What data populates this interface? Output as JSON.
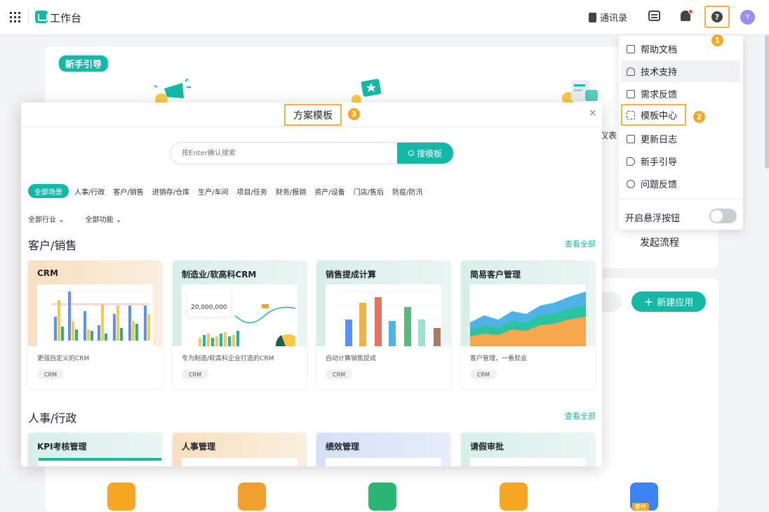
{
  "topbar": {
    "app_title": "工作台",
    "contacts_label": "通讯录",
    "avatar_letter": "Y"
  },
  "background": {
    "guide_badge": "新手引导",
    "right_label": "仪表",
    "launch_flow": "发起流程",
    "new_app_button": "新建应用",
    "bottom_badge": "套件"
  },
  "help_menu": {
    "items": [
      {
        "label": "帮助文档",
        "icon": "book-open-icon"
      },
      {
        "label": "技术支持",
        "icon": "headset-icon"
      },
      {
        "label": "需求反馈",
        "icon": "chat-icon"
      },
      {
        "label": "模板中心",
        "icon": "grid-icon"
      },
      {
        "label": "更新日志",
        "icon": "log-icon"
      },
      {
        "label": "新手引导",
        "icon": "signpost-icon"
      },
      {
        "label": "问题反馈",
        "icon": "smile-icon"
      }
    ],
    "float_button_label": "开启悬浮按钮",
    "float_button_on": false
  },
  "callouts": [
    "1",
    "2",
    "3"
  ],
  "modal": {
    "title": "方案模板",
    "close_glyph": "×",
    "search": {
      "placeholder": "按Enter确认搜索",
      "button_label": "搜模板"
    },
    "categories": [
      "全部场景",
      "人事/行政",
      "客户/销售",
      "进销存/仓库",
      "生产/车间",
      "项目/任务",
      "财务/报销",
      "资产/设备",
      "门店/售后",
      "防疫/防汛"
    ],
    "filters": [
      "全部行业",
      "全部功能"
    ],
    "sections": [
      {
        "title": "客户/销售",
        "view_all": "查看全部",
        "cards": [
          {
            "name": "CRM",
            "desc": "更强自定义的CRM",
            "tag": "CRM"
          },
          {
            "name": "制造业/软高科CRM",
            "desc": "专为制造/软高科企业打造的CRM",
            "tag": "CRM",
            "metric": "20,000,000"
          },
          {
            "name": "销售提成计算",
            "desc": "自动计算销售提成",
            "tag": "CRM"
          },
          {
            "name": "简易客户管理",
            "desc": "客户管理，一看就会",
            "tag": "CRM"
          }
        ]
      },
      {
        "title": "人事/行政",
        "view_all": "查看全部",
        "cards": [
          {
            "name": "KPI考核管理"
          },
          {
            "name": "人事管理"
          },
          {
            "name": "绩效管理"
          },
          {
            "name": "请假审批"
          }
        ]
      }
    ]
  },
  "colors": {
    "accent": "#14b8a6",
    "highlight_border": "#f5b042",
    "callout": "#f5a623"
  }
}
